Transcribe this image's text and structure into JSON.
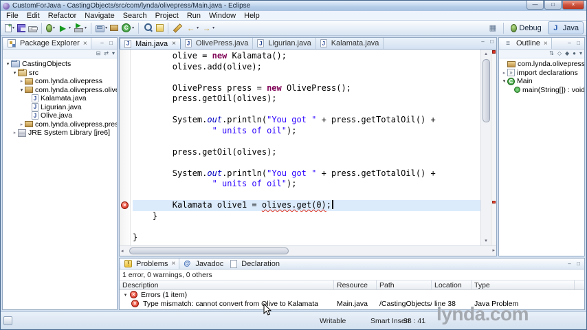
{
  "window": {
    "title": "CustomForJava - CastingObjects/src/com/lynda/olivepress/Main.java - Eclipse",
    "controls": [
      {
        "name": "minimize",
        "glyph": "—"
      },
      {
        "name": "maximize",
        "glyph": "□"
      },
      {
        "name": "close",
        "glyph": "×"
      }
    ]
  },
  "colors": {
    "title_bar": "#b6cde8",
    "keyword": "#7f0055",
    "string": "#2a00ff",
    "static_field": "#0000c0",
    "error_red": "#d42310",
    "current_line": "#dcebfc"
  },
  "menu_bar": {
    "items": [
      "File",
      "Edit",
      "Refactor",
      "Navigate",
      "Search",
      "Project",
      "Run",
      "Window",
      "Help"
    ]
  },
  "toolbar": {
    "groups": [
      {
        "icons": [
          {
            "name": "new-wizard",
            "glyph": "page",
            "dropdown": true
          },
          {
            "name": "save",
            "glyph": "save"
          },
          {
            "name": "print",
            "glyph": "print"
          }
        ]
      },
      {
        "icons": [
          {
            "name": "debug",
            "glyph": "bug",
            "dropdown": true
          },
          {
            "name": "run",
            "glyph": "run",
            "dropdown": true
          },
          {
            "name": "external-tools",
            "glyph": "tool",
            "dropdown": true
          }
        ]
      },
      {
        "icons": [
          {
            "name": "new-java-project",
            "glyph": "project",
            "dropdown": true
          },
          {
            "name": "new-package",
            "glyph": "package"
          },
          {
            "name": "new-class",
            "glyph": "class",
            "dropdown": true
          }
        ]
      },
      {
        "icons": [
          {
            "name": "search",
            "glyph": "search"
          },
          {
            "name": "externalize-strings",
            "glyph": "mark"
          }
        ]
      },
      {
        "icons": [
          {
            "name": "last-edit-location",
            "glyph": "edit"
          },
          {
            "name": "back",
            "glyph": "left",
            "dropdown": true
          },
          {
            "name": "forward",
            "glyph": "right",
            "dropdown": true
          }
        ]
      }
    ],
    "perspective_bar": {
      "open_button": {
        "name": "open-perspective",
        "glyph": "grid"
      },
      "perspectives": [
        {
          "name": "debug-perspective",
          "label": "Debug",
          "glyph": "bug",
          "active": false
        },
        {
          "name": "java-perspective",
          "label": "Java",
          "glyph": "jperspective",
          "active": true
        }
      ]
    }
  },
  "package_explorer": {
    "title": "Package Explorer",
    "toolbar": [
      {
        "name": "collapse-all",
        "glyph": "⊟"
      },
      {
        "name": "link-with-editor",
        "glyph": "⇄"
      },
      {
        "name": "view-menu",
        "glyph": "▾"
      }
    ],
    "tree": [
      {
        "label": "CastingObjects",
        "depth": 0,
        "icon": "project",
        "expand": "open"
      },
      {
        "label": "src",
        "depth": 1,
        "icon": "src",
        "expand": "open"
      },
      {
        "label": "com.lynda.olivepress",
        "depth": 2,
        "icon": "package",
        "expand": "closed"
      },
      {
        "label": "com.lynda.olivepress.olives",
        "depth": 2,
        "icon": "package",
        "expand": "open"
      },
      {
        "label": "Kalamata.java",
        "depth": 3,
        "icon": "jfile"
      },
      {
        "label": "Ligurian.java",
        "depth": 3,
        "icon": "jfile"
      },
      {
        "label": "Olive.java",
        "depth": 3,
        "icon": "jfile"
      },
      {
        "label": "com.lynda.olivepress.press",
        "depth": 2,
        "icon": "package",
        "expand": "closed"
      },
      {
        "label": "JRE System Library [jre6]",
        "depth": 1,
        "icon": "library",
        "expand": "closed"
      }
    ]
  },
  "editor": {
    "tabs": [
      {
        "label": "Main.java",
        "active": true
      },
      {
        "label": "OlivePress.java",
        "active": false
      },
      {
        "label": "Ligurian.java",
        "active": false
      },
      {
        "label": "Kalamata.java",
        "active": false
      }
    ],
    "lines": [
      {
        "segs": [
          [
            "p",
            "        olive = "
          ],
          [
            "k",
            "new"
          ],
          [
            "p",
            " Kalamata();"
          ]
        ]
      },
      {
        "segs": [
          [
            "p",
            "        olives.add(olive);"
          ]
        ]
      },
      {
        "segs": []
      },
      {
        "segs": [
          [
            "p",
            "        OlivePress press = "
          ],
          [
            "k",
            "new"
          ],
          [
            "p",
            " OlivePress();"
          ]
        ]
      },
      {
        "segs": [
          [
            "p",
            "        press.getOil(olives);"
          ]
        ]
      },
      {
        "segs": []
      },
      {
        "segs": [
          [
            "p",
            "        System."
          ],
          [
            "f",
            "out"
          ],
          [
            "p",
            ".println("
          ],
          [
            "s",
            "\"You got \""
          ],
          [
            "p",
            " + press.getTotalOil() +"
          ]
        ]
      },
      {
        "segs": [
          [
            "p",
            "                "
          ],
          [
            "s",
            "\" units of oil\""
          ],
          [
            "p",
            ");"
          ]
        ]
      },
      {
        "segs": []
      },
      {
        "segs": [
          [
            "p",
            "        press.getOil(olives);"
          ]
        ]
      },
      {
        "segs": []
      },
      {
        "segs": [
          [
            "p",
            "        System."
          ],
          [
            "f",
            "out"
          ],
          [
            "p",
            ".println("
          ],
          [
            "s",
            "\"You got \""
          ],
          [
            "p",
            " + press.getTotalOil() +"
          ]
        ]
      },
      {
        "segs": [
          [
            "p",
            "                "
          ],
          [
            "s",
            "\" units of oil\""
          ],
          [
            "p",
            ");"
          ]
        ]
      },
      {
        "segs": []
      },
      {
        "segs": [
          [
            "p",
            "        Kalamata olive1 = "
          ],
          [
            "e",
            "olives.get(0)"
          ],
          [
            "p",
            ";"
          ]
        ],
        "current": true,
        "caret": true
      },
      {
        "segs": [
          [
            "p",
            "    }"
          ]
        ]
      },
      {
        "segs": []
      },
      {
        "segs": [
          [
            "p",
            "}"
          ]
        ]
      }
    ]
  },
  "outline": {
    "title": "Outline",
    "toolbar": [
      {
        "name": "sort",
        "glyph": "⇅"
      },
      {
        "name": "hide-fields",
        "glyph": "◇"
      },
      {
        "name": "hide-static-members",
        "glyph": "◆"
      },
      {
        "name": "hide-non-public",
        "glyph": "●"
      },
      {
        "name": "view-menu",
        "glyph": "▾"
      }
    ],
    "tree": [
      {
        "label": "com.lynda.olivepress",
        "depth": 0,
        "icon": "package"
      },
      {
        "label": "import declarations",
        "depth": 0,
        "icon": "imports",
        "expand": "closed"
      },
      {
        "label": "Main",
        "depth": 0,
        "icon": "class",
        "expand": "open"
      },
      {
        "label": "main(String[]) : void",
        "depth": 1,
        "icon": "method"
      }
    ]
  },
  "problems": {
    "tabs": [
      {
        "label": "Problems",
        "icon": "problems",
        "active": true
      },
      {
        "label": "Javadoc",
        "icon": "javadoc",
        "active": false
      },
      {
        "label": "Declaration",
        "icon": "declaration",
        "active": false
      }
    ],
    "summary": "1 error, 0 warnings, 0 others",
    "columns": [
      "Description",
      "Resource",
      "Path",
      "Location",
      "Type"
    ],
    "group": {
      "label": "Errors (1 item)"
    },
    "rows": [
      {
        "description": "Type mismatch: cannot convert from Olive to Kalamata",
        "resource": "Main.java",
        "path": "/CastingObjects/sr...",
        "location": "line 38",
        "type": "Java Problem"
      }
    ]
  },
  "status_bar": {
    "writable": "Writable",
    "insert_mode": "Smart Insert",
    "caret_position": "38 : 41"
  },
  "watermark": "lynda.com"
}
